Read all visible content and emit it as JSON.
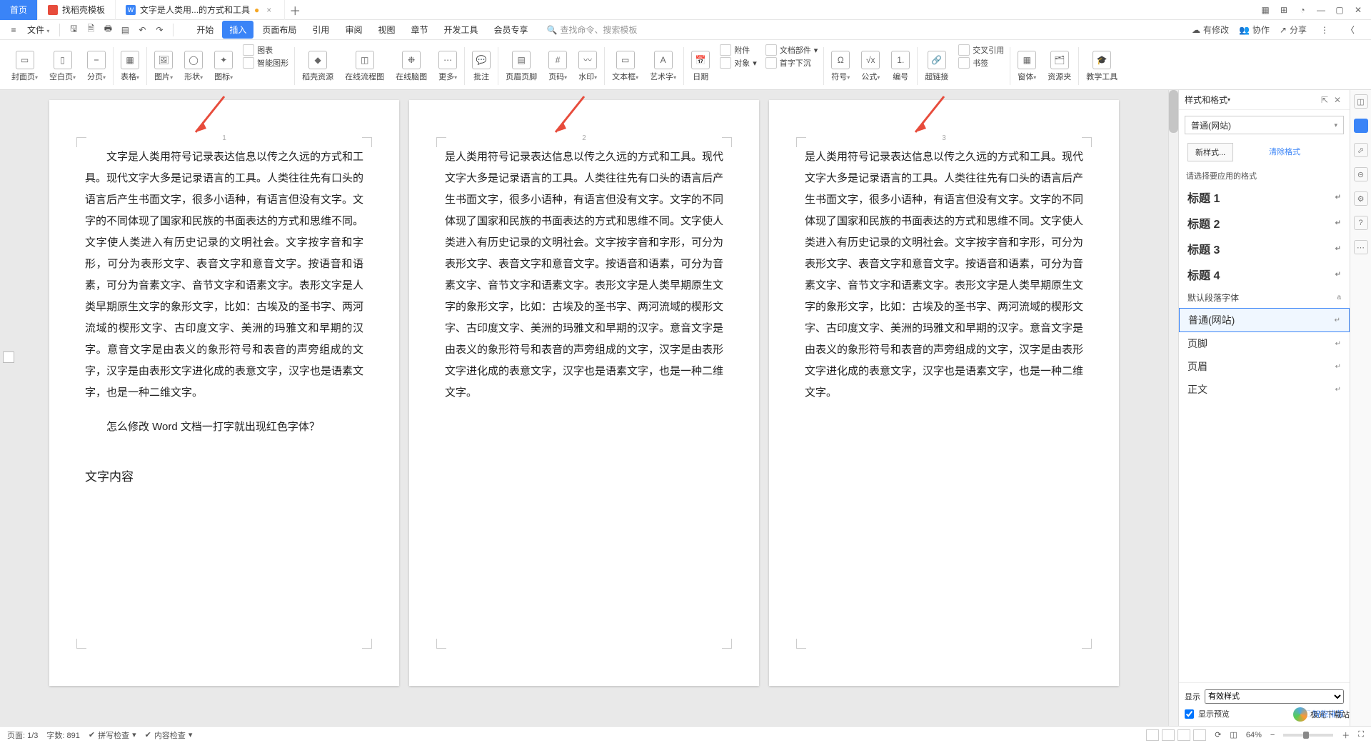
{
  "tabs": {
    "home": "首页",
    "t1": "找稻壳模板",
    "t2": "文字是人类用...的方式和工具",
    "t2_dirty": "●"
  },
  "file_menu": "文件",
  "menu": {
    "items": [
      "开始",
      "插入",
      "页面布局",
      "引用",
      "审阅",
      "视图",
      "章节",
      "开发工具",
      "会员专享"
    ],
    "selected": 1,
    "search_placeholder": "查找命令、搜索模板"
  },
  "menubar_right": {
    "changes": "有修改",
    "collab": "协作",
    "share": "分享"
  },
  "ribbon": {
    "cover": "封面页",
    "blank": "空白页",
    "break": "分页",
    "table": "表格",
    "pic": "图片",
    "shape": "形状",
    "icon": "图标",
    "chart": "图表",
    "smart": "智能图形",
    "dk": "稻壳资源",
    "flow": "在线流程图",
    "mind": "在线脑图",
    "more": "更多",
    "comment": "批注",
    "headerfooter": "页眉页脚",
    "pagenum": "页码",
    "watermark": "水印",
    "textbox": "文本框",
    "wordart": "艺术字",
    "date": "日期",
    "attach": "附件",
    "obj": "对象",
    "docpart": "文档部件",
    "dropcap": "首字下沉",
    "symbol": "符号",
    "equation": "公式",
    "number": "编号",
    "hyperlink": "超链接",
    "xref": "交叉引用",
    "bookmark": "书签",
    "window": "窗体",
    "rsrc": "资源夹",
    "edutool": "教学工具"
  },
  "doc": {
    "p1a": "文字是人类用符号记录表达信息以传之久远的方式和工具。现代文字大多是记录语言的工具。人类往往先有口头的语言后产生书面文字，很多小语种，有语言但没有文字。文字的不同体现了国家和民族的书面表达的方式和思维不同。文字使人类进入有历史记录的文明社会。文字按字音和字形，可分为表形文字、表音文字和意音文字。按语音和语素，可分为音素文字、音节文字和语素文字。表形文字是人类早期原生文字的象形文字，比如：古埃及的圣书字、两河流域的楔形文字、古印度文字、美洲的玛雅文和早期的汉字。意音文字是由表义的象形符号和表音的声旁组成的文字，汉字是由表形文字进化成的表意文字，汉字也是语素文字，也是一种二维文字。",
    "p1b": "怎么修改 Word 文档一打字就出现红色字体？",
    "p1c": "文字内容",
    "p23": "是人类用符号记录表达信息以传之久远的方式和工具。现代文字大多是记录语言的工具。人类往往先有口头的语言后产生书面文字，很多小语种，有语言但没有文字。文字的不同体现了国家和民族的书面表达的方式和思维不同。文字使人类进入有历史记录的文明社会。文字按字音和字形，可分为表形文字、表音文字和意音文字。按语音和语素，可分为音素文字、音节文字和语素文字。表形文字是人类早期原生文字的象形文字，比如：古埃及的圣书字、两河流域的楔形文字、古印度文字、美洲的玛雅文和早期的汉字。意音文字是由表义的象形符号和表音的声旁组成的文字，汉字是由表形文字进化成的表意文字，汉字也是语素文字，也是一种二维文字。"
  },
  "panel": {
    "title": "样式和格式",
    "current": "普通(网站)",
    "new": "新样式...",
    "clear": "清除格式",
    "prompt": "请选择要应用的格式",
    "items": [
      {
        "label": "标题 1",
        "h": true
      },
      {
        "label": "标题 2",
        "h": true
      },
      {
        "label": "标题 3",
        "h": true
      },
      {
        "label": "标题 4",
        "h": true
      },
      {
        "label": "默认段落字体",
        "small": true,
        "mark": "a"
      },
      {
        "label": "普通(网站)",
        "sel": true
      },
      {
        "label": "页脚"
      },
      {
        "label": "页眉"
      },
      {
        "label": "正文"
      }
    ],
    "show": "显示",
    "show_val": "有效样式",
    "preview": "显示预览",
    "smartlayout": "智能排版"
  },
  "status": {
    "page": "页面: 1/3",
    "words": "字数: 891",
    "spell": "拼写检查",
    "content": "内容检查",
    "zoom": "64%"
  },
  "brand": "极光下载站"
}
